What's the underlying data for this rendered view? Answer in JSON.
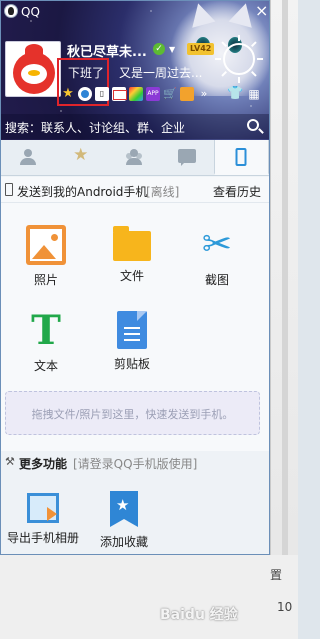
{
  "window": {
    "title": "QQ"
  },
  "profile": {
    "nickname": "秋已尽草未...",
    "level_badge": "LV42",
    "status": "下班了",
    "signature": "又是一周过去..."
  },
  "search": {
    "label": "搜索：联系人、讨论组、群、企业"
  },
  "tabs": [
    {
      "name": "contacts"
    },
    {
      "name": "favorites"
    },
    {
      "name": "groups"
    },
    {
      "name": "messages"
    },
    {
      "name": "my-device",
      "active": true
    }
  ],
  "device": {
    "title": "发送到我的Android手机",
    "status": "[离线]",
    "history_label": "查看历史"
  },
  "functions": {
    "photo": "照片",
    "file": "文件",
    "screenshot": "截图",
    "text": "文本",
    "clipboard": "剪贴板"
  },
  "drop_zone": {
    "hint": "拖拽文件/照片到这里，快速发送到手机。"
  },
  "more": {
    "title": "更多功能",
    "hint": "[请登录QQ手机版使用]",
    "items": {
      "export_album": "导出手机相册",
      "add_favorite": "添加收藏"
    }
  },
  "background": {
    "partial_text": "置",
    "partial_number": "10"
  },
  "watermark": {
    "text": "Baidu 经验"
  },
  "colors": {
    "accent": "#2b8fd8",
    "status_highlight": "#e0242b",
    "photo_icon": "#f09238",
    "file_icon": "#f7b51c",
    "text_icon": "#21a84a"
  }
}
